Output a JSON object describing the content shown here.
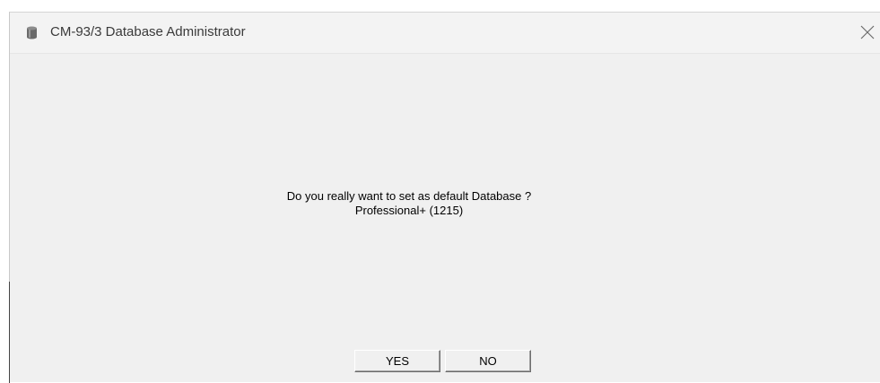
{
  "window": {
    "title": "CM-93/3 Database Administrator",
    "icon": "database-cylinder-icon",
    "close_icon": "close-icon"
  },
  "dialog": {
    "message_line1": "Do you really want to set as default Database ?",
    "message_line2": "Professional+ (1215)"
  },
  "buttons": {
    "yes_label": "YES",
    "no_label": "NO"
  },
  "colors": {
    "window_bg": "#f0f0f0",
    "titlebar_bg": "#f3f3f3",
    "title_text": "#3a3a3a"
  }
}
